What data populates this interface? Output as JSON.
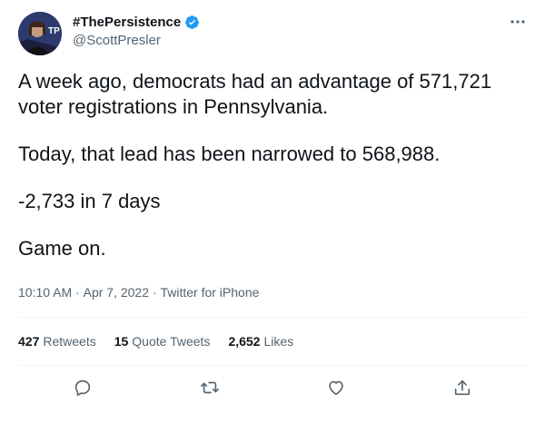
{
  "author": {
    "display_name": "#ThePersistence",
    "handle": "@ScottPresler",
    "verified": true,
    "avatar_badge_text": "TP"
  },
  "tweet": {
    "paragraphs": [
      "A week ago, democrats had an advantage of 571,721 voter registrations in Pennsylvania.",
      "Today, that lead has been narrowed to 568,988.",
      "-2,733 in 7 days",
      "Game on."
    ]
  },
  "meta": {
    "time": "10:10 AM",
    "separator_1": " · ",
    "date": "Apr 7, 2022",
    "separator_2": " · ",
    "source": "Twitter for iPhone"
  },
  "stats": {
    "retweets_count": "427",
    "retweets_label": "Retweets",
    "quote_tweets_count": "15",
    "quote_tweets_label": "Quote Tweets",
    "likes_count": "2,652",
    "likes_label": "Likes"
  },
  "actions": [
    "reply-icon",
    "retweet-icon",
    "like-icon",
    "share-icon"
  ],
  "colors": {
    "text": "#0f1419",
    "secondary": "#536471",
    "divider": "#eff3f4",
    "verified": "#1d9bf0"
  }
}
